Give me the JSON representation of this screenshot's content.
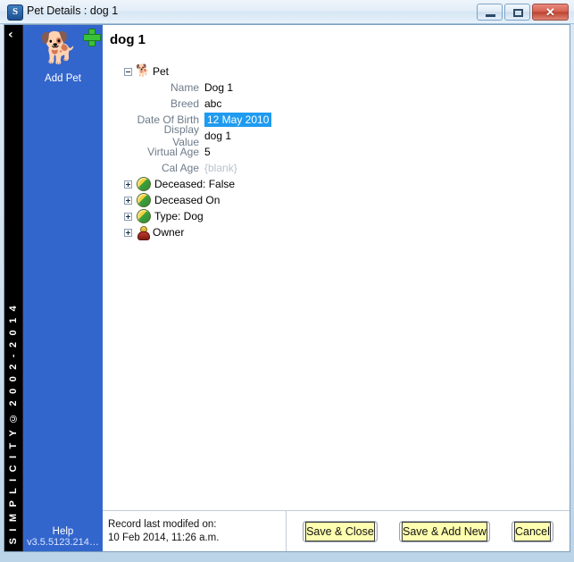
{
  "window": {
    "title": "Pet Details : dog 1",
    "app_icon": "S",
    "minimize_label": "–",
    "maximize_label": "□",
    "close_label": "✕"
  },
  "sidebar": {
    "collapse_icon": "‹",
    "vertical_text": "S I M P L I C I T Y  ©  2 0 0 2 - 2 0 1 4",
    "add_pet": {
      "label": "Add Pet",
      "icon": "🐕",
      "badge": "plus-badge"
    },
    "help_label": "Help",
    "version": "v3.5.5123.214…"
  },
  "main": {
    "page_title": "dog 1",
    "tree": {
      "root": {
        "label": "Pet",
        "expander": "minus",
        "icon": "dog-icon"
      },
      "fields": [
        {
          "label": "Name",
          "value": "Dog 1",
          "state": "normal"
        },
        {
          "label": "Breed",
          "value": "abc",
          "state": "normal"
        },
        {
          "label": "Date Of Birth",
          "value": "12 May 2010",
          "state": "selected"
        },
        {
          "label": "Display Value",
          "value": "dog 1",
          "state": "normal"
        },
        {
          "label": "Virtual Age",
          "value": "5",
          "state": "normal"
        },
        {
          "label": "Cal Age",
          "value": "{blank}",
          "state": "blank"
        }
      ],
      "nodes": [
        {
          "label": "Deceased:  False",
          "expander": "plus",
          "icon": "sphere-icon"
        },
        {
          "label": "Deceased On",
          "expander": "plus",
          "icon": "sphere-icon"
        },
        {
          "label": "Type:  Dog",
          "expander": "plus",
          "icon": "sphere-icon"
        },
        {
          "label": "Owner",
          "expander": "plus",
          "icon": "person-icon"
        }
      ]
    }
  },
  "footer": {
    "modified_label": "Record last modifed on:",
    "modified_value": "10 Feb 2014, 11:26 a.m.",
    "buttons": [
      {
        "label": "Save & Close"
      },
      {
        "label": "Save & Add New"
      },
      {
        "label": "Cancel"
      }
    ]
  },
  "colors": {
    "sidebar_blue": "#3366cc",
    "selection_blue": "#1f9bf0",
    "button_yellow": "#ffffb0",
    "close_red": "#bc3f2d"
  }
}
